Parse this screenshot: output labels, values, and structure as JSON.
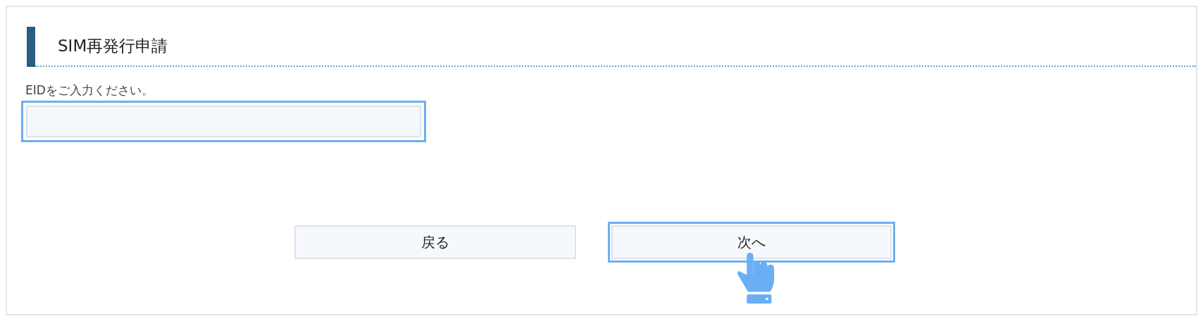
{
  "heading": "SIM再発行申請",
  "eid_field": {
    "label": "EIDをご入力ください。",
    "focused": true
  },
  "buttons": [
    {
      "label": "戻る",
      "focused": false
    },
    {
      "label": "次へ",
      "focused": true
    }
  ]
}
